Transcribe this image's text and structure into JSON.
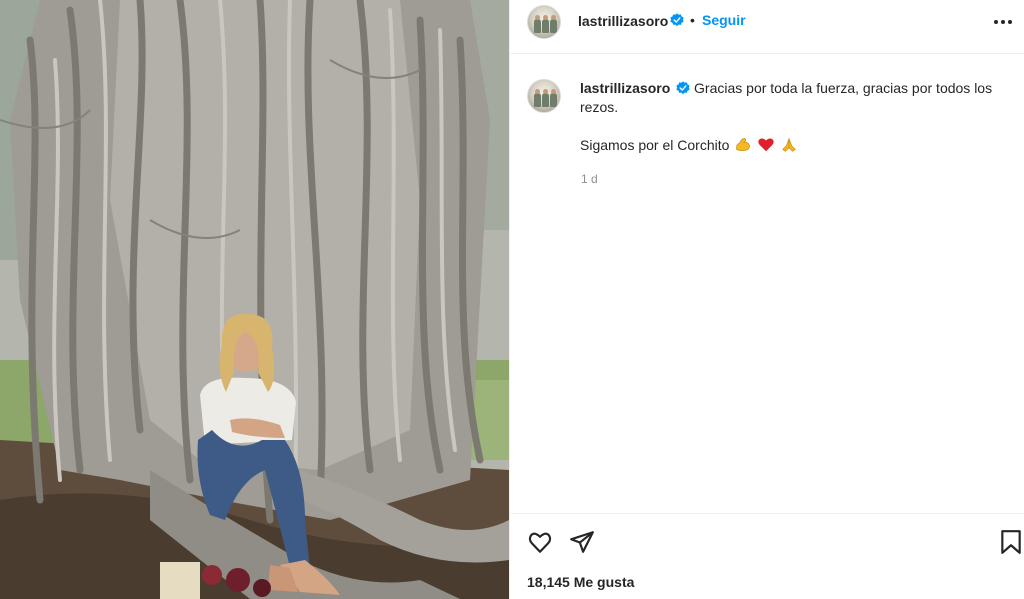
{
  "post": {
    "image_alt": "photo",
    "author": {
      "username": "lastrillizasoro",
      "verified_icon": "verified-badge-icon",
      "follow_label": "Seguir",
      "separator": "•"
    },
    "caption": {
      "username": "lastrillizasoro",
      "text_line1": "Gracias por toda la fuerza, gracias por todos los rezos.",
      "text_line2": "Sigamos por el Corchito",
      "emojis": [
        "flexed-biceps-emoji",
        "red-heart-emoji",
        "folded-hands-emoji"
      ]
    },
    "timestamp": "1 d",
    "likes": "18,145 Me gusta"
  },
  "icons": {
    "more": "more-options-icon",
    "like": "heart-outline-icon",
    "share": "share-arrow-icon",
    "save": "bookmark-icon"
  },
  "colors": {
    "accent": "#0095f6",
    "verified": "#0095f6",
    "text": "#262626",
    "muted": "#8e8e8e",
    "border": "#efefef"
  }
}
